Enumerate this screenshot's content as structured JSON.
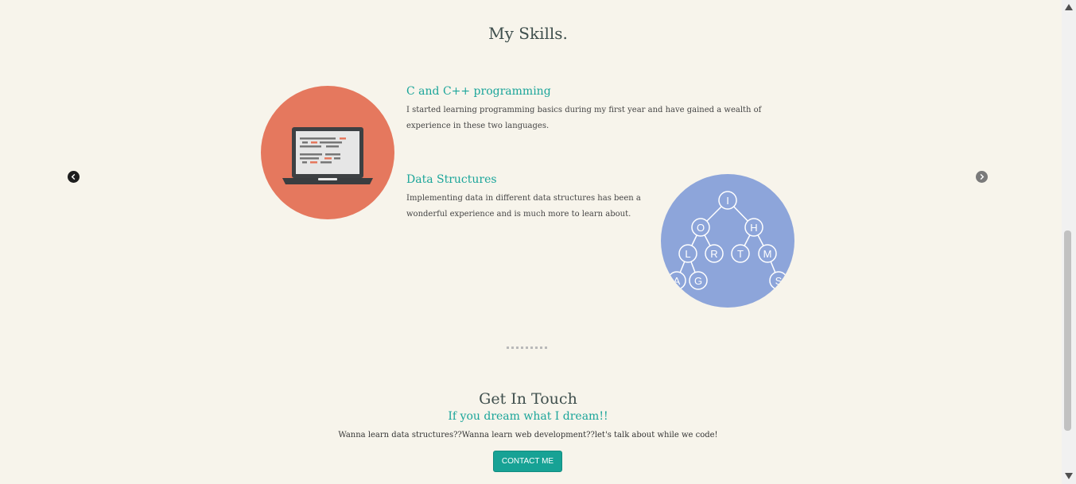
{
  "skills": {
    "heading": "My Skills.",
    "items": [
      {
        "title": "C and C++ programming",
        "description": "I started learning programming basics during my first year and have gained a wealth of experience in these two languages.",
        "icon": "laptop-icon"
      },
      {
        "title": "Data Structures",
        "description": "Implementing data in different data structures has been a wonderful experience and is much more to learn about.",
        "icon": "binary-tree-icon"
      }
    ],
    "tree_nodes": [
      "I",
      "O",
      "H",
      "L",
      "R",
      "T",
      "M",
      "A",
      "G",
      "S"
    ]
  },
  "carousel": {
    "prev_icon": "chevron-left-icon",
    "next_icon": "chevron-right-icon"
  },
  "contact": {
    "heading": "Get In Touch",
    "subheading": "If you dream what I dream!!",
    "text": "Wanna learn data structures??Wanna learn web development??let's talk about while we code!",
    "button_label": "CONTACT ME"
  },
  "colors": {
    "background": "#f7f4eb",
    "accent": "#1ba59a",
    "laptop_circle": "#e5785e",
    "tree_circle": "#8da5da"
  }
}
